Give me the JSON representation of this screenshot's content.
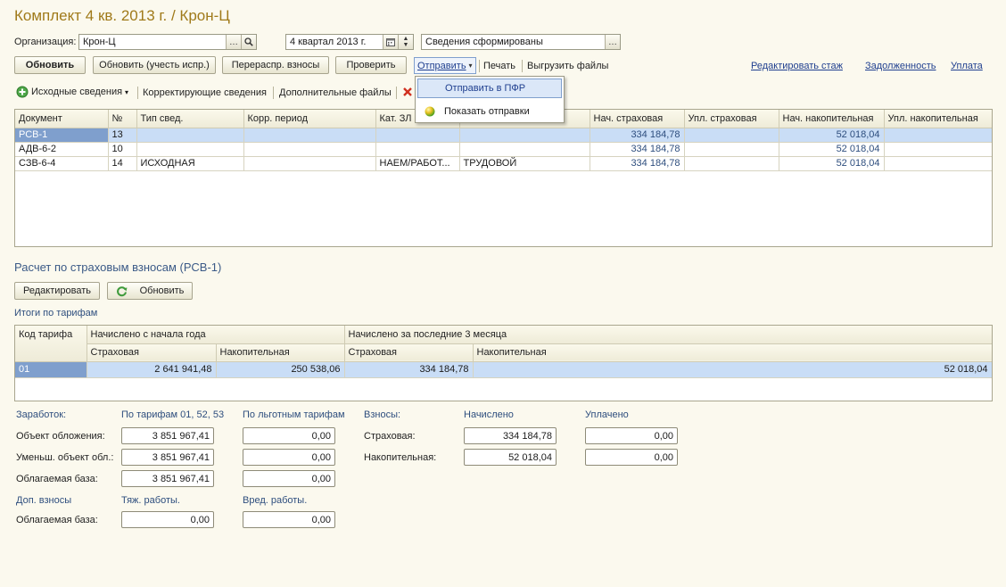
{
  "window": {
    "title": "Комплект 4 кв. 2013 г. / Крон-Ц"
  },
  "header": {
    "org_label": "Организация:",
    "org_value": "Крон-Ц",
    "period_value": "4 квартал 2013 г.",
    "status_value": "Сведения сформированы"
  },
  "toolbar": {
    "refresh": "Обновить",
    "refresh_corr": "Обновить (учесть испр.)",
    "redistribute": "Перераспр. взносы",
    "check": "Проверить",
    "send": "Отправить",
    "print": "Печать",
    "export": "Выгрузить файлы",
    "edit_seniority": "Редактировать стаж",
    "debt": "Задолженность",
    "payment": "Уплата"
  },
  "subtoolbar": {
    "source": "Исходные сведения",
    "corrective": "Корректирующие сведения",
    "additional": "Дополнительные файлы"
  },
  "send_menu": {
    "items": [
      "Отправить в ПФР",
      "Показать отправки"
    ]
  },
  "docs_table": {
    "columns": [
      "Документ",
      "№",
      "Тип свед.",
      "Корр. период",
      "Кат. ЗЛ",
      "",
      "Нач. страховая",
      "Упл. страховая",
      "Нач. накопительная",
      "Упл. накопительная"
    ],
    "rows": [
      [
        "РСВ-1",
        "13",
        "",
        "",
        "",
        "",
        "334 184,78",
        "",
        "52 018,04",
        ""
      ],
      [
        "АДВ-6-2",
        "10",
        "",
        "",
        "",
        "",
        "334 184,78",
        "",
        "52 018,04",
        ""
      ],
      [
        "СЗВ-6-4",
        "14",
        "ИСХОДНАЯ",
        "",
        "НАЕМ/РАБОТ...",
        "ТРУДОВОЙ",
        "334 184,78",
        "",
        "52 018,04",
        ""
      ]
    ]
  },
  "rsv": {
    "title": "Расчет по страховым взносам (РСВ-1)",
    "edit": "Редактировать",
    "refresh": "Обновить",
    "tariff_title": "Итоги по тарифам"
  },
  "tariff_table": {
    "code_header": "Код тарифа",
    "group1": "Начислено с начала года",
    "group2": "Начислено за последние 3 месяца",
    "sub": [
      "Страховая",
      "Накопительная",
      "Страховая",
      "Накопительная"
    ],
    "rows": [
      [
        "01",
        "2 641 941,48",
        "250 538,06",
        "334 184,78",
        "52 018,04"
      ]
    ]
  },
  "summary": {
    "earnings": "Заработок:",
    "by_tariffs": "По тарифам 01, 52, 53",
    "by_pref": "По льготным тарифам",
    "contrib": "Взносы:",
    "accrued": "Начислено",
    "paid": "Уплачено",
    "object": "Объект обложения:",
    "reduced": "Уменьш. объект обл.:",
    "base": "Облагаемая база:",
    "insurance": "Страховая:",
    "funded": "Накопительная:",
    "object_v1": "3 851 967,41",
    "object_v2": "0,00",
    "reduced_v1": "3 851 967,41",
    "reduced_v2": "0,00",
    "base_v1": "3 851 967,41",
    "base_v2": "0,00",
    "ins_accrued": "334 184,78",
    "ins_paid": "0,00",
    "fund_accrued": "52 018,04",
    "fund_paid": "0,00",
    "extra": "Доп. взносы",
    "heavy": "Тяж. работы.",
    "harmful": "Вред. работы.",
    "extra_base": "Облагаемая база:",
    "extra_v1": "0,00",
    "extra_v2": "0,00"
  }
}
